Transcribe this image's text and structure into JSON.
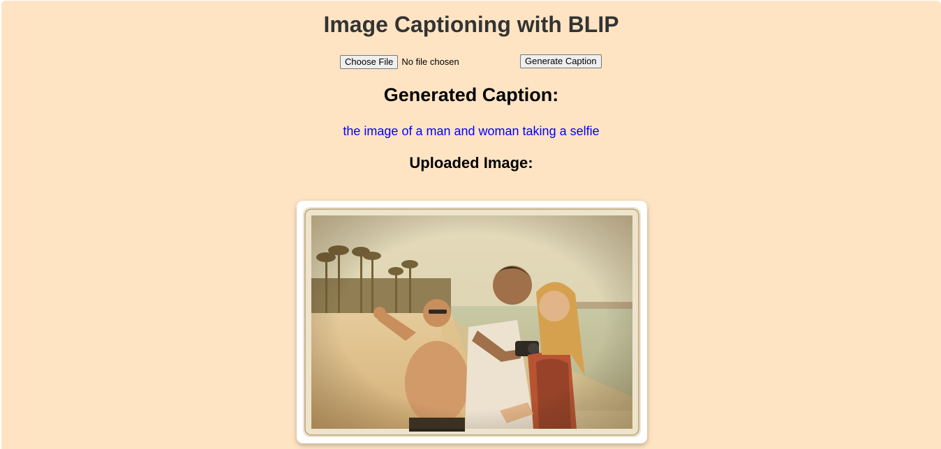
{
  "header": {
    "title": "Image Captioning with BLIP"
  },
  "upload": {
    "choose_file_label": "Choose File",
    "file_status": "No file chosen",
    "generate_label": "Generate Caption"
  },
  "result": {
    "caption_heading": "Generated Caption:",
    "caption_text": "the image of a man and woman taking a selfie",
    "image_heading": "Uploaded Image:"
  },
  "colors": {
    "background": "#ffe4c4",
    "title": "#333333",
    "caption_text": "#0000ff"
  }
}
